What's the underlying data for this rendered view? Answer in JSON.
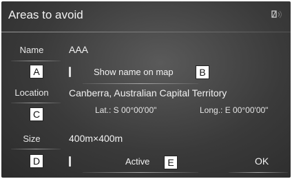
{
  "header": {
    "title": "Areas to avoid",
    "status_icon": "gps-signal-icon"
  },
  "fields": {
    "name": {
      "label": "Name",
      "value": "AAA"
    },
    "location": {
      "label": "Location",
      "value": "Canberra, Australian Capital Territory",
      "lat": "Lat.: S 00°00'00\"",
      "long": "Long.: E 00°00'00\""
    },
    "size": {
      "label": "Size",
      "value": "400m×400m"
    }
  },
  "buttons": {
    "show_name": "Show name on map",
    "active": "Active",
    "ok": "OK"
  },
  "callouts": {
    "a": "A",
    "b": "B",
    "c": "C",
    "d": "D",
    "e": "E"
  }
}
